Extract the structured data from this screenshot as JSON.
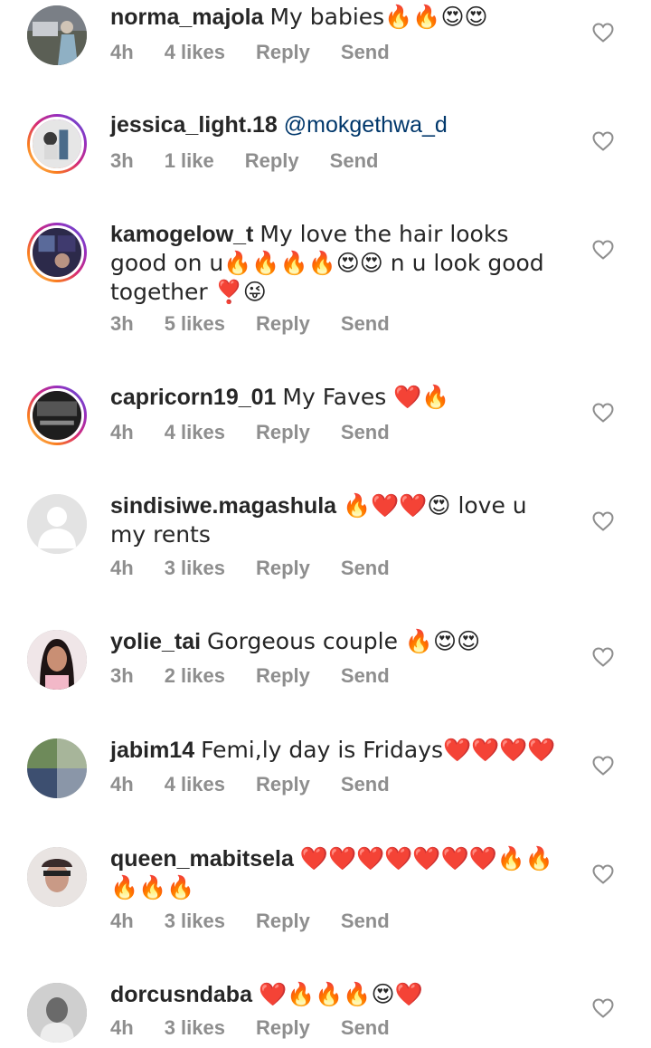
{
  "comments": [
    {
      "username": "norma_majola",
      "text": "My babies🔥🔥😍😍",
      "mention": "",
      "time": "4h",
      "likes": "4 likes",
      "reply": "Reply",
      "send": "Send"
    },
    {
      "username": "jessica_light.18",
      "text": "",
      "mention": "@mokgethwa_d",
      "time": "3h",
      "likes": "1 like",
      "reply": "Reply",
      "send": "Send"
    },
    {
      "username": "kamogelow_t",
      "text": "My love the hair looks good on u🔥🔥🔥🔥😍😍 n u look good together ❣️😜",
      "mention": "",
      "time": "3h",
      "likes": "5 likes",
      "reply": "Reply",
      "send": "Send"
    },
    {
      "username": "capricorn19_01",
      "text": "My Faves ❤️🔥",
      "mention": "",
      "time": "4h",
      "likes": "4 likes",
      "reply": "Reply",
      "send": "Send"
    },
    {
      "username": "sindisiwe.magashula",
      "text": "🔥❤️❤️😍 love u my rents",
      "mention": "",
      "time": "4h",
      "likes": "3 likes",
      "reply": "Reply",
      "send": "Send"
    },
    {
      "username": "yolie_tai",
      "text": "Gorgeous couple 🔥😍😍",
      "mention": "",
      "time": "3h",
      "likes": "2 likes",
      "reply": "Reply",
      "send": "Send"
    },
    {
      "username": "jabim14",
      "text": "Femi,ly day is Fridays❤️❤️❤️❤️",
      "mention": "",
      "time": "4h",
      "likes": "4 likes",
      "reply": "Reply",
      "send": "Send"
    },
    {
      "username": "queen_mabitsela",
      "text": "❤️❤️❤️❤️❤️❤️❤️🔥🔥🔥🔥🔥",
      "mention": "",
      "time": "4h",
      "likes": "3 likes",
      "reply": "Reply",
      "send": "Send"
    },
    {
      "username": "dorcusndaba",
      "text": "❤️🔥🔥🔥😍❤️",
      "mention": "",
      "time": "4h",
      "likes": "3 likes",
      "reply": "Reply",
      "send": "Send"
    }
  ],
  "colors": {
    "text": "#262626",
    "meta": "#8e8e8e",
    "mention": "#00376b"
  }
}
